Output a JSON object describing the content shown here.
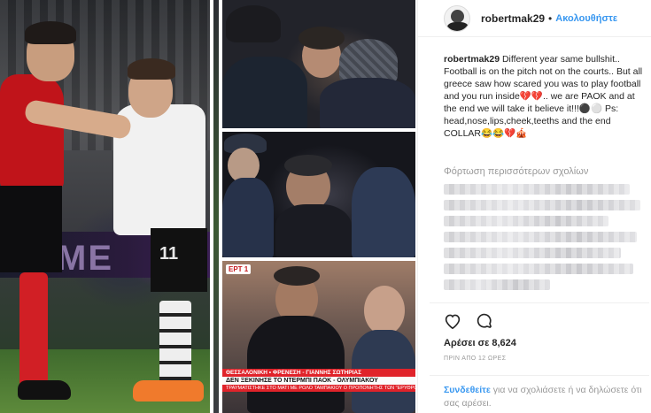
{
  "header": {
    "username": "robertmak29",
    "separator": "•",
    "follow_label": "Ακολουθήστε"
  },
  "caption": {
    "username": "robertmak29",
    "text": "Different year same bullshit.. Football is on the pitch not on the courts.. But all greece saw how scared you was to play football and you run inside💔💔.. we are PAOK and at the end we will take it believe it!!!⚫⚪ Ps: head,nose,lips,cheek,teeths and the end COLLAR😂😂💔🎪"
  },
  "comments": {
    "load_more_label": "Φόρτωση περισσότερων σχολίων"
  },
  "media": {
    "main_photo": {
      "ad_text": "ME",
      "player_number": "11"
    },
    "tv_photo": {
      "channel_logo": "ΕΡΤ 1",
      "ticker_line1": "ΘΕΣΣΑΛΟΝΙΚΗ • ΦΡΕΝΕΣΗ - ΓΙΑΝΝΗΣ ΣΩΤΗΡΙΑΣ",
      "ticker_line2": "ΔΕΝ ΞΕΚΙΝΗΣΕ ΤΟ ΝΤΕΡΜΠΙ ΠΑΟΚ - ΟΛΥΜΠΙΑΚΟΥ",
      "ticker_line3": "ΤΡΑΥΜΑΤΙΣΤΗΚΕ ΣΤΟ ΜΑΤΙ ΜΕ ΡΟΛΟ ΤΑΜΠΑΚΙΟΥ Ο ΠΡΟΠΟΝΗΤΗΣ ΤΩΝ \"ΕΡΥΘΡΟΛΕΥΚΩΝ\""
    }
  },
  "actions": {
    "like_icon": "heart-icon",
    "comment_icon": "comment-bubble-icon"
  },
  "likes": {
    "label": "Αρέσει σε 8,624"
  },
  "timestamp": {
    "label": "ΠΡΙΝ ΑΠΟ 12 ΩΡΕΣ"
  },
  "login_prompt": {
    "link_label": "Συνδεθείτε",
    "rest": "για να σχολιάσετε ή να δηλώσετε ότι σας αρέσει."
  }
}
